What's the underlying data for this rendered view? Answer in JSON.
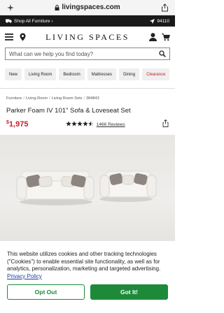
{
  "browser": {
    "url": "livingspaces.com",
    "url_prefix_icon": "lock-icon"
  },
  "top_strip": {
    "shop_all": "Shop All Furniture ›",
    "zip": "94110"
  },
  "header": {
    "logo": "LIVING SPACES"
  },
  "search": {
    "placeholder": "What can we help you find today?"
  },
  "categories": [
    "New",
    "Living Room",
    "Bedroom",
    "Mattresses",
    "Dining",
    "Clearance"
  ],
  "breadcrumb": [
    "Furniture",
    "Living Room",
    "Living Room Sets",
    "384843"
  ],
  "product": {
    "title": "Parker Foam IV 101\" Sofa & Loveseat Set",
    "currency": "$",
    "price": "1,975",
    "rating": 4.5,
    "reviews": "1466 Reviews"
  },
  "cookie": {
    "text": "This website utilizes cookies and other tracking technologies (\"Cookies\") to enable essential site functionality, as well as for analytics, personalization, marketing and targeted advertising.",
    "link": "Privacy Policy",
    "opt_out": "Opt Out",
    "got_it": "Got It!"
  },
  "colors": {
    "accent_red": "#c4202a",
    "brand_green": "#1d8a3a",
    "top_strip": "#1a1a1a"
  }
}
